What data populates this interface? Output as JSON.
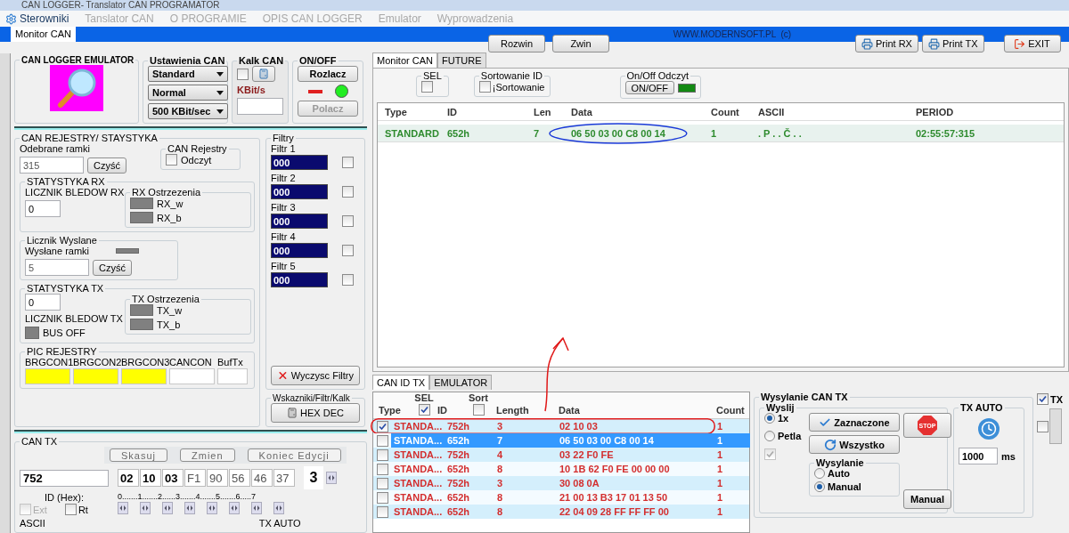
{
  "window": {
    "title": "CAN LOGGER- Translator CAN PROGRAMATOR"
  },
  "menu": [
    {
      "label": "Sterowniki",
      "disabled": false
    },
    {
      "label": "Tanslator CAN",
      "disabled": true
    },
    {
      "label": "O PROGRAMIE",
      "disabled": true
    },
    {
      "label": "OPIS CAN LOGGER",
      "disabled": true
    },
    {
      "label": "Emulator",
      "disabled": true
    },
    {
      "label": "Wyprowadzenia",
      "disabled": true
    }
  ],
  "main_tabs": [
    {
      "label": "Monitor CAN",
      "selected": true
    }
  ],
  "toolbar": {
    "expand": "Rozwin",
    "collapse": "Zwin",
    "site": "WWW.MODERNSOFT.PL  (c)",
    "print_rx": "Print RX",
    "print_tx": "Print TX",
    "exit": "EXIT"
  },
  "logo": {
    "title": "CAN LOGGER EMULATOR"
  },
  "settings": {
    "title": "Ustawienia CAN",
    "dropdowns": [
      "Standard",
      "Normal",
      "500 KBit/sec"
    ]
  },
  "kalk": {
    "title": "Kalk CAN",
    "checked": false,
    "unit": "KBit/s"
  },
  "onoff": {
    "title": "ON/OFF",
    "disconnect": "Rozlacz",
    "connect": "Polacz",
    "connected": true
  },
  "registers": {
    "title": "CAN REJESTRY/ STAYSTYKA",
    "received_label": "Odebrane ramki",
    "received": "315",
    "clear": "Czyść",
    "can_reg": {
      "title": "CAN Rejestry",
      "label": "Odczyt",
      "checked": false
    }
  },
  "rx_stats": {
    "title": "STATYSTYKA RX",
    "error_label": "LICZNIK BLEDOW RX",
    "errors": "0",
    "warnings_title": "RX Ostrzezenia",
    "warnings": [
      {
        "label": "RX_w",
        "on": false
      },
      {
        "label": "RX_b",
        "on": false
      }
    ]
  },
  "sent": {
    "title": "Licznik Wyslane",
    "label": "Wysłane ramki",
    "value": "5",
    "clear": "Czyść"
  },
  "tx_stats": {
    "title": "STATYSTYKA TX",
    "errors": "0",
    "error_label": "LICZNIK BLEDOW TX",
    "bus_off": {
      "label": "BUS OFF",
      "on": false
    },
    "warnings_title": "TX Ostrzezenia",
    "warnings": [
      {
        "label": "TX_w",
        "on": false
      },
      {
        "label": "TX_b",
        "on": false
      }
    ]
  },
  "pic": {
    "title": "PIC REJESTRY",
    "registers": [
      {
        "label": "BRGCON1",
        "color": "#ffff00"
      },
      {
        "label": "BRGCON2",
        "color": "#ffff00"
      },
      {
        "label": "BRGCON3",
        "color": "#ffff00"
      },
      {
        "label": "CANCON",
        "color": "#ffffff"
      },
      {
        "label": "BufTx",
        "color": "#ffffff"
      }
    ]
  },
  "filters": {
    "title": "Filtry",
    "items": [
      {
        "label": "Filtr 1",
        "value": "000",
        "checked": false
      },
      {
        "label": "Filtr 2",
        "value": "000",
        "checked": false
      },
      {
        "label": "Filtr 3",
        "value": "000",
        "checked": false
      },
      {
        "label": "Filtr 4",
        "value": "000",
        "checked": false
      },
      {
        "label": "Filtr 5",
        "value": "000",
        "checked": false
      }
    ],
    "clear": "Wyczysc Filtry"
  },
  "indicators": {
    "title": "Wskazniki/Filtr/Kalk",
    "button": "HEX DEC"
  },
  "can_tx": {
    "title": "CAN TX",
    "buttons": [
      "Skasuj",
      "Zmien",
      "Koniec Edycji"
    ],
    "id": "752",
    "id_label": "ID (Hex):",
    "bytes": [
      {
        "value": "02",
        "active": true
      },
      {
        "value": "10",
        "active": true
      },
      {
        "value": "03",
        "active": true
      },
      {
        "value": "F1",
        "active": false
      },
      {
        "value": "90",
        "active": false
      },
      {
        "value": "56",
        "active": false
      },
      {
        "value": "46",
        "active": false
      },
      {
        "value": "37",
        "active": false
      }
    ],
    "byte_scale": "0.......1.......2......3.......4.......5.......6.....7",
    "length": "3",
    "ext": {
      "label": "Ext",
      "checked": false,
      "disabled": true
    },
    "rt": {
      "label": "Rt",
      "checked": false
    },
    "ascii_title": "ASCII",
    "tx_auto_title": "TX AUTO"
  },
  "monitor_tabs": [
    {
      "label": "Monitor CAN",
      "selected": true
    },
    {
      "label": "FUTURE",
      "selected": false
    }
  ],
  "sel": {
    "title": "SEL",
    "checked": false
  },
  "sort": {
    "title": "Sortowanie ID",
    "label": "¡Sortowanie",
    "checked": false
  },
  "read_toggle": {
    "title": "On/Off Odczyt",
    "button": "ON/OFF",
    "on": true
  },
  "rx_table": {
    "columns": [
      "Type",
      "ID",
      "Len",
      "Data",
      "Count",
      "ASCII",
      "PERIOD"
    ],
    "rows": [
      {
        "cells": [
          "STANDARD",
          "652h",
          "7",
          "06 50 03 00 C8 00 14",
          "1",
          ". P . . Č . .",
          "02:55:57:315"
        ]
      }
    ]
  },
  "tx_tabs": [
    {
      "label": "CAN ID TX",
      "selected": true
    },
    {
      "label": "EMULATOR",
      "selected": false
    }
  ],
  "tx_table": {
    "columns": [
      "Type",
      "SEL",
      "ID",
      "Sort",
      "Length",
      "Data",
      "Count"
    ],
    "sel_checked": true,
    "sort_checked": false,
    "rows": [
      {
        "checked": true,
        "selected": false,
        "type": "STANDA...",
        "id": "752h",
        "length": "3",
        "data": "02 10 03",
        "count": "1"
      },
      {
        "checked": false,
        "selected": true,
        "type": "STANDA...",
        "id": "652h",
        "length": "7",
        "data": "06 50 03 00 C8 00 14",
        "count": "1"
      },
      {
        "checked": false,
        "selected": false,
        "type": "STANDA...",
        "id": "752h",
        "length": "4",
        "data": "03 22 F0 FE",
        "count": "1"
      },
      {
        "checked": false,
        "selected": false,
        "type": "STANDA...",
        "id": "652h",
        "length": "8",
        "data": "10 1B 62 F0 FE 00 00 00",
        "count": "1"
      },
      {
        "checked": false,
        "selected": false,
        "type": "STANDA...",
        "id": "752h",
        "length": "3",
        "data": "30 08 0A",
        "count": "1"
      },
      {
        "checked": false,
        "selected": false,
        "type": "STANDA...",
        "id": "652h",
        "length": "8",
        "data": "21 00 13 B3 17 01 13 50",
        "count": "1"
      },
      {
        "checked": false,
        "selected": false,
        "type": "STANDA...",
        "id": "652h",
        "length": "8",
        "data": "22 04 09 28 FF FF FF 00",
        "count": "1"
      }
    ]
  },
  "send": {
    "title": "Wysylanie CAN TX",
    "group": "Wyslij",
    "modes": [
      {
        "label": "1x",
        "selected": true
      },
      {
        "label": "Petla",
        "selected": false
      }
    ],
    "loop_checked": true,
    "selected_button": "Zaznaczone",
    "all_button": "Wszystko",
    "stop": "STOP",
    "sending": {
      "title": "Wysylanie",
      "options": [
        {
          "label": "Auto",
          "selected": false
        },
        {
          "label": "Manual",
          "selected": true
        }
      ]
    },
    "manual": "Manual",
    "tx_auto": {
      "title": "TX AUTO",
      "interval": "1000",
      "unit": "ms"
    }
  },
  "tx_toggle": {
    "label": "TX",
    "checked": true,
    "second_checked": false
  }
}
